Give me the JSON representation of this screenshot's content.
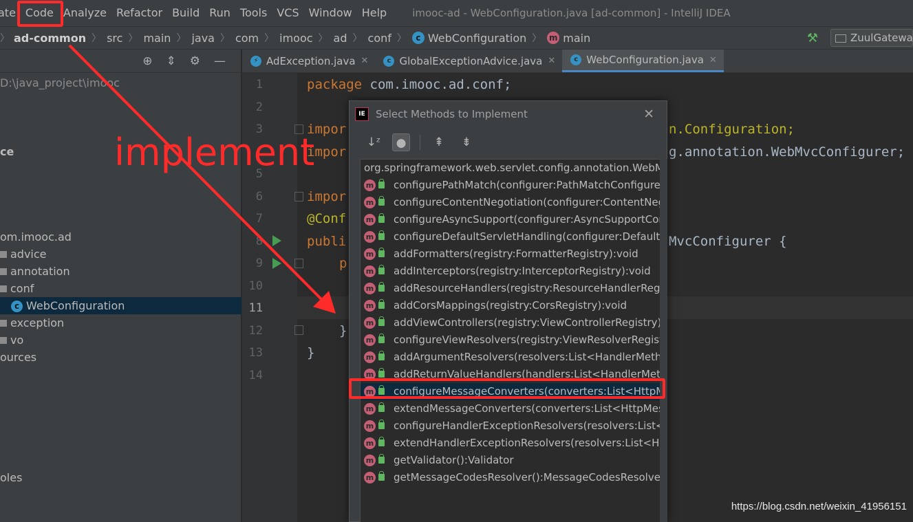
{
  "menu": {
    "items": [
      "ate",
      "Code",
      "Analyze",
      "Refactor",
      "Build",
      "Run",
      "Tools",
      "VCS",
      "Window",
      "Help"
    ],
    "window_title": "imooc-ad - WebConfiguration.java [ad-common] - IntelliJ IDEA"
  },
  "navbar": {
    "crumbs": [
      "ad-common",
      "src",
      "main",
      "java",
      "com",
      "imooc",
      "ad",
      "conf",
      "WebConfiguration",
      "main"
    ],
    "run_config": "ZuulGateway"
  },
  "project": {
    "path": "D:\\java_project\\imooc",
    "tree": [
      "ce",
      "om.imooc.ad",
      "advice",
      "annotation",
      "conf",
      "WebConfiguration",
      "exception",
      "vo",
      "ources",
      "oles"
    ]
  },
  "tabs": [
    {
      "label": "AdException.java"
    },
    {
      "label": "GlobalExceptionAdvice.java"
    },
    {
      "label": "WebConfiguration.java"
    }
  ],
  "editor": {
    "line_numbers": [
      "1",
      "2",
      "3",
      "",
      "5",
      "6",
      "7",
      "8",
      "9",
      "10",
      "11",
      "12",
      "13",
      "14"
    ],
    "code": {
      "l1_kw": "package",
      "l1_rest": " com.imooc.ad.conf;",
      "l3_kw": "impor",
      "l3_rest": "n.Configuration;",
      "l4_kw": "impor",
      "l4_rest": "g.annotation.WebMvcConfigurer;",
      "l6_kw": "impor",
      "l7_ann": "@Conf",
      "l8_kw": "publi",
      "l8_rest": "MvcConfigurer {",
      "l9_kw": "p",
      "l12": "}",
      "l13": "}"
    }
  },
  "dialog": {
    "title": "Select Methods to Implement",
    "header": "org.springframework.web.servlet.config.annotation.WebMvcConfigurer",
    "methods": [
      "configurePathMatch(configurer:PathMatchConfigurer):void",
      "configureContentNegotiation(configurer:ContentNegotiationConfigurer):void",
      "configureAsyncSupport(configurer:AsyncSupportConfigurer):void",
      "configureDefaultServletHandling(configurer:DefaultServletHandlerConfigurer):void",
      "addFormatters(registry:FormatterRegistry):void",
      "addInterceptors(registry:InterceptorRegistry):void",
      "addResourceHandlers(registry:ResourceHandlerRegistry):void",
      "addCorsMappings(registry:CorsRegistry):void",
      "addViewControllers(registry:ViewControllerRegistry):void",
      "configureViewResolvers(registry:ViewResolverRegistry):void",
      "addArgumentResolvers(resolvers:List<HandlerMethodArgumentResolver>):void",
      "addReturnValueHandlers(handlers:List<HandlerMethodReturnValueHandler>):void",
      "configureMessageConverters(converters:List<HttpMessageConverter<?>>):void",
      "extendMessageConverters(converters:List<HttpMessageConverter<?>>):void",
      "configureHandlerExceptionResolvers(resolvers:List<HandlerExceptionResolver>):void",
      "extendHandlerExceptionResolvers(resolvers:List<HandlerExceptionResolver>):void",
      "getValidator():Validator",
      "getMessageCodesResolver():MessageCodesResolver"
    ]
  },
  "annotation": {
    "text": "implement",
    "color": "#ff2a2a"
  },
  "watermark": "https://blog.csdn.net/weixin_41956151"
}
